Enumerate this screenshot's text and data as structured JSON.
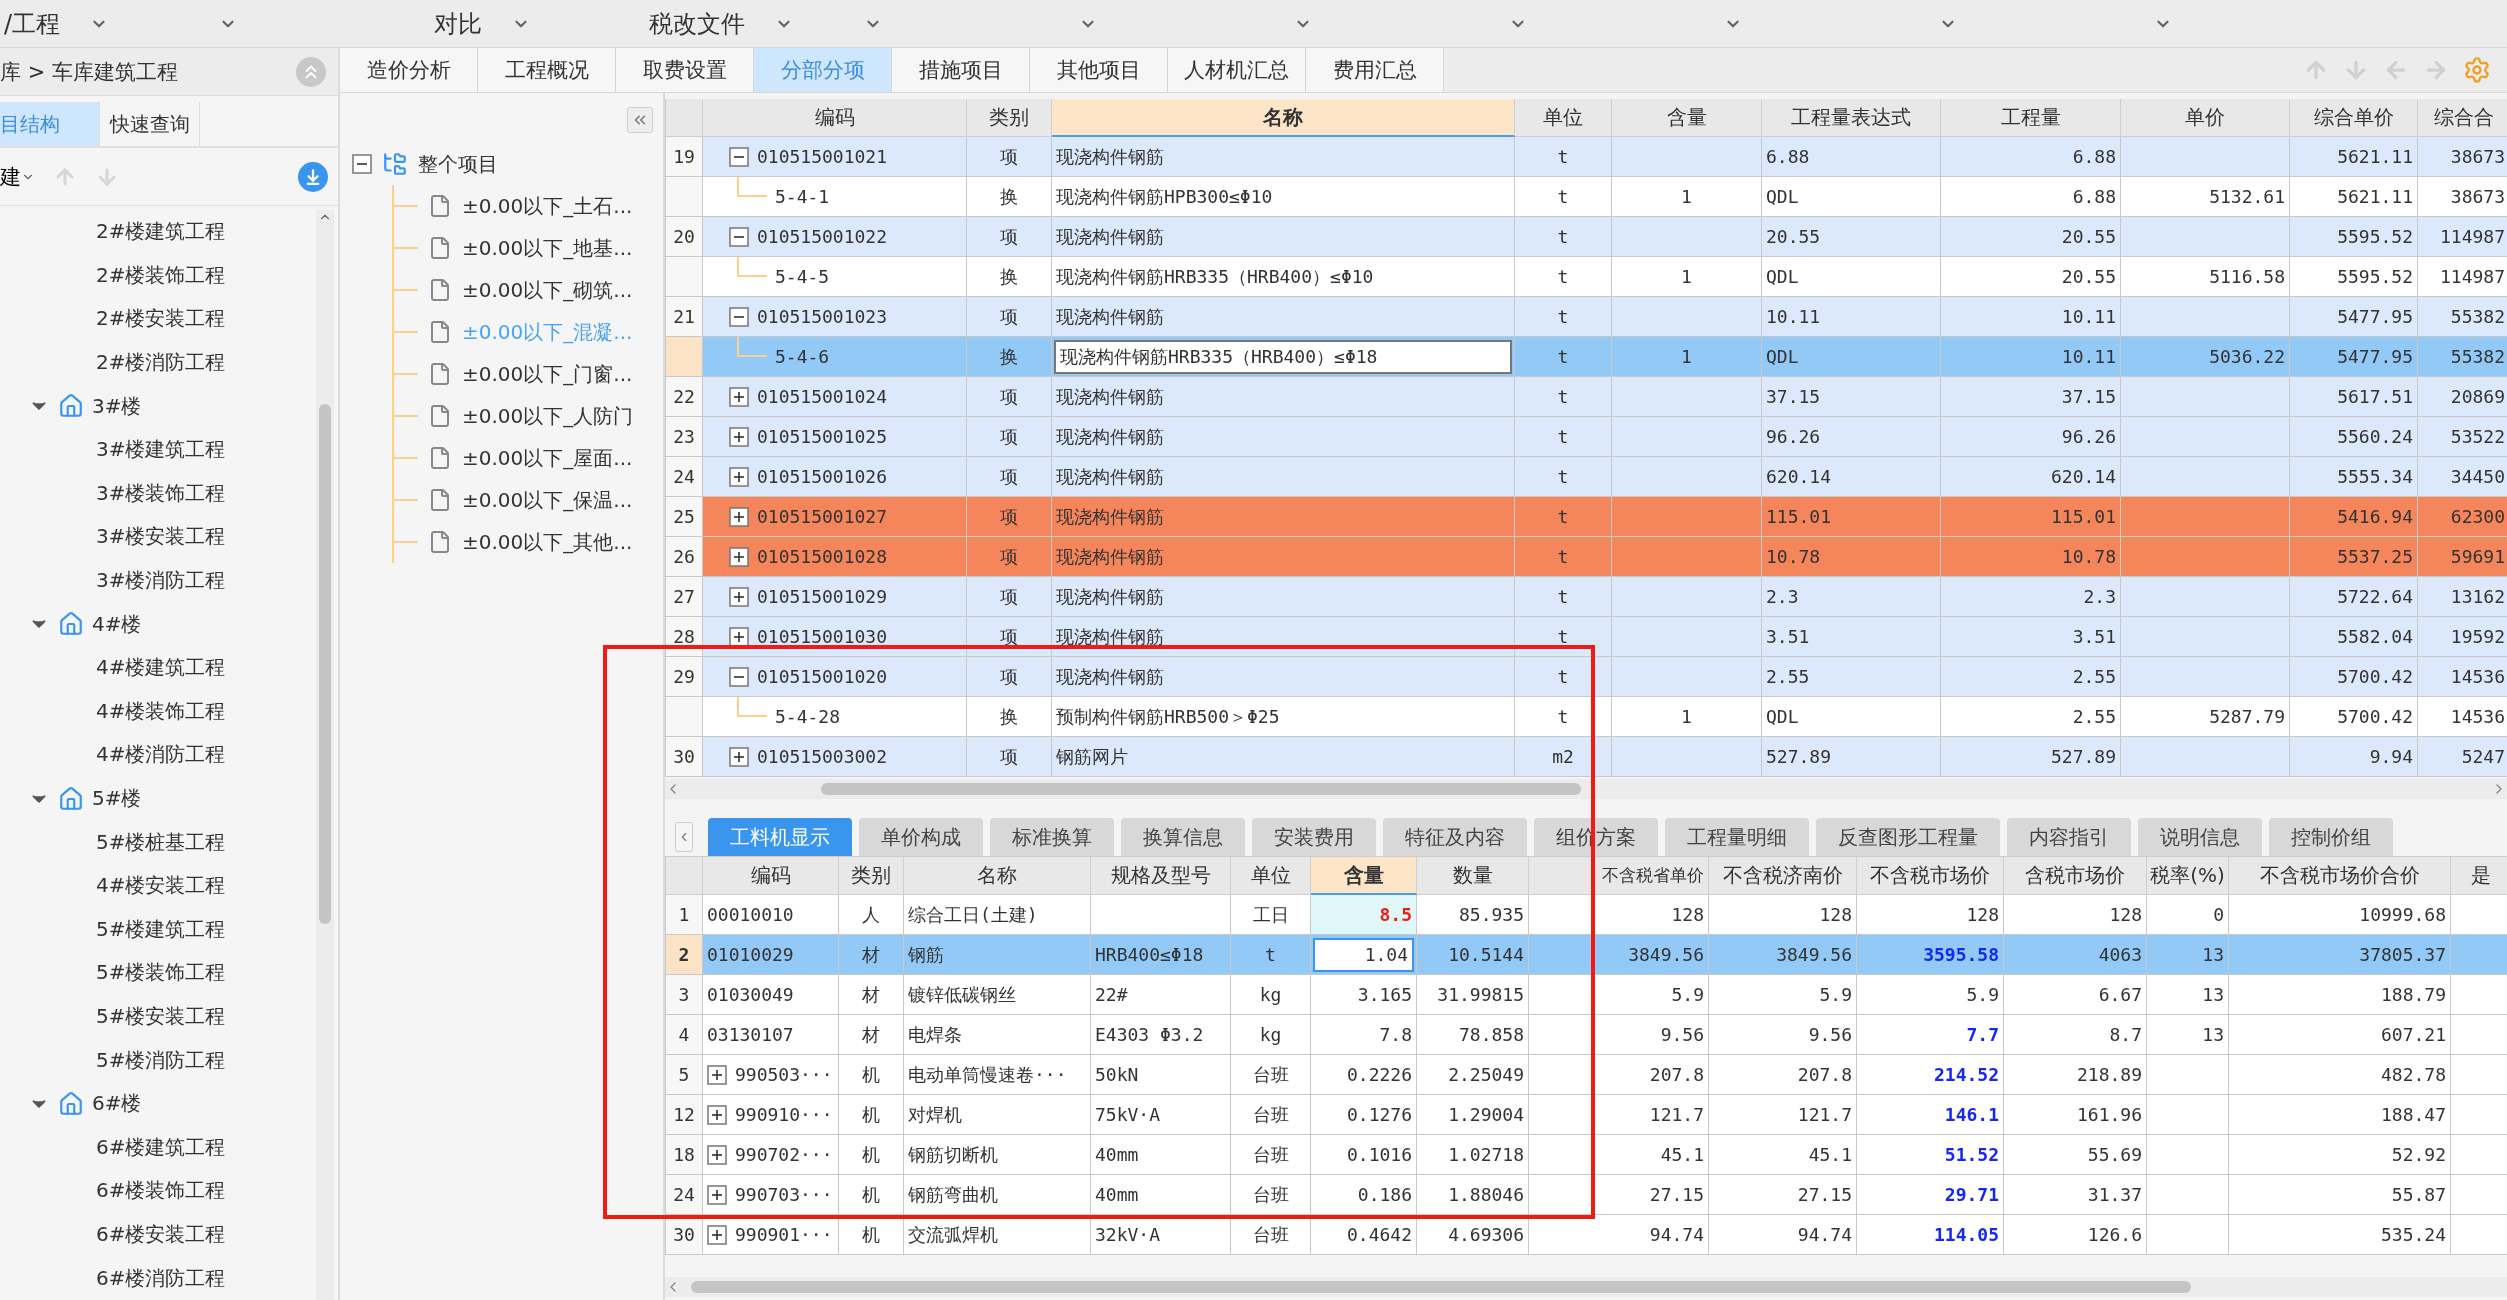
{
  "toolbar": {
    "items": [
      {
        "label": "/工程",
        "dropdown": true
      },
      {
        "dropdown": true
      },
      {
        "label": "对比",
        "dropdown": true
      },
      {
        "label": "税改文件",
        "dropdown": true
      },
      {
        "dropdown": true
      },
      {
        "dropdown": true
      },
      {
        "dropdown": true
      },
      {
        "dropdown": true
      },
      {
        "dropdown": true
      },
      {
        "dropdown": true
      },
      {
        "dropdown": true
      }
    ]
  },
  "left_panel": {
    "breadcrumb": "库 > 车库建筑工程",
    "tabs": [
      {
        "label": "目结构",
        "selected": true
      },
      {
        "label": "快速查询",
        "selected": false
      }
    ],
    "new_label": "建",
    "building_tree": [
      {
        "label": "2#楼建筑工程"
      },
      {
        "label": "2#楼装饰工程"
      },
      {
        "label": "2#楼安装工程"
      },
      {
        "label": "2#楼消防工程"
      },
      {
        "label": "3#楼",
        "expanded": true,
        "children": [
          {
            "label": "3#楼建筑工程"
          },
          {
            "label": "3#楼装饰工程"
          },
          {
            "label": "3#楼安装工程"
          },
          {
            "label": "3#楼消防工程"
          }
        ]
      },
      {
        "label": "4#楼",
        "expanded": true,
        "children": [
          {
            "label": "4#楼建筑工程"
          },
          {
            "label": "4#楼装饰工程"
          },
          {
            "label": "4#楼消防工程"
          }
        ]
      },
      {
        "label": "5#楼",
        "expanded": true,
        "children": [
          {
            "label": "5#楼桩基工程"
          },
          {
            "label": "4#楼安装工程"
          },
          {
            "label": "5#楼建筑工程"
          },
          {
            "label": "5#楼装饰工程"
          },
          {
            "label": "5#楼安装工程"
          },
          {
            "label": "5#楼消防工程"
          }
        ]
      },
      {
        "label": "6#楼",
        "expanded": true,
        "children": [
          {
            "label": "6#楼建筑工程"
          },
          {
            "label": "6#楼装饰工程"
          },
          {
            "label": "6#楼安装工程"
          },
          {
            "label": "6#楼消防工程"
          }
        ]
      }
    ]
  },
  "main_tabs": [
    {
      "label": "造价分析",
      "selected": false
    },
    {
      "label": "工程概况",
      "selected": false
    },
    {
      "label": "取费设置",
      "selected": false
    },
    {
      "label": "分部分项",
      "selected": true
    },
    {
      "label": "措施项目",
      "selected": false
    },
    {
      "label": "其他项目",
      "selected": false
    },
    {
      "label": "人材机汇总",
      "selected": false
    },
    {
      "label": "费用汇总",
      "selected": false
    }
  ],
  "project_tree": {
    "label": "整个项目",
    "expanded": true,
    "children": [
      {
        "label": "±0.00以下_土石...",
        "selected": false
      },
      {
        "label": "±0.00以下_地基...",
        "selected": false
      },
      {
        "label": "±0.00以下_砌筑...",
        "selected": false
      },
      {
        "label": "±0.00以下_混凝...",
        "selected": true
      },
      {
        "label": "±0.00以下_门窗...",
        "selected": false
      },
      {
        "label": "±0.00以下_人防门",
        "selected": false
      },
      {
        "label": "±0.00以下_屋面...",
        "selected": false
      },
      {
        "label": "±0.00以下_保温...",
        "selected": false
      },
      {
        "label": "±0.00以下_其他...",
        "selected": false
      }
    ]
  },
  "upper_table": {
    "columns": [
      {
        "label": "编码",
        "active": false
      },
      {
        "label": "类别",
        "active": false
      },
      {
        "label": "名称",
        "active": true
      },
      {
        "label": "单位",
        "active": false
      },
      {
        "label": "含量",
        "active": false
      },
      {
        "label": "工程量表达式",
        "active": false
      },
      {
        "label": "工程量",
        "active": false
      },
      {
        "label": "单价",
        "active": false
      },
      {
        "label": "综合单价",
        "active": false
      },
      {
        "label": "综合合",
        "active": false
      }
    ],
    "rows": [
      {
        "kind": "item",
        "num": "19",
        "expanded": true,
        "code": "010515001021",
        "category": "项",
        "name": "现浇构件钢筋",
        "unit": "t",
        "expr": "6.88",
        "qty": "6.88",
        "unit_total": "5621.11",
        "total": "38673",
        "selected": false,
        "flagged": false
      },
      {
        "kind": "sub",
        "code": "5-4-1",
        "category": "换",
        "name": "现浇构件钢筋HPB300≤Φ10",
        "unit": "t",
        "content": "1",
        "expr": "QDL",
        "qty": "6.88",
        "price": "5132.61",
        "unit_total": "5621.11",
        "total": "38673",
        "selected": false,
        "flagged": false
      },
      {
        "kind": "item",
        "num": "20",
        "expanded": true,
        "code": "010515001022",
        "category": "项",
        "name": "现浇构件钢筋",
        "unit": "t",
        "expr": "20.55",
        "qty": "20.55",
        "unit_total": "5595.52",
        "total": "114987",
        "selected": false,
        "flagged": false
      },
      {
        "kind": "sub",
        "code": "5-4-5",
        "category": "换",
        "name": "现浇构件钢筋HRB335（HRB400）≤Φ10",
        "unit": "t",
        "content": "1",
        "expr": "QDL",
        "qty": "20.55",
        "price": "5116.58",
        "unit_total": "5595.52",
        "total": "114987",
        "selected": false,
        "flagged": false
      },
      {
        "kind": "item",
        "num": "21",
        "expanded": true,
        "code": "010515001023",
        "category": "项",
        "name": "现浇构件钢筋",
        "unit": "t",
        "expr": "10.11",
        "qty": "10.11",
        "unit_total": "5477.95",
        "total": "55382",
        "selected": false,
        "flagged": false
      },
      {
        "kind": "sub",
        "code": "5-4-6",
        "category": "换",
        "name": "现浇构件钢筋HRB335（HRB400）≤Φ18",
        "unit": "t",
        "content": "1",
        "expr": "QDL",
        "qty": "10.11",
        "price": "5036.22",
        "unit_total": "5477.95",
        "total": "55382",
        "selected": true,
        "flagged": false
      },
      {
        "kind": "item",
        "num": "22",
        "expanded": false,
        "code": "010515001024",
        "category": "项",
        "name": "现浇构件钢筋",
        "unit": "t",
        "expr": "37.15",
        "qty": "37.15",
        "unit_total": "5617.51",
        "total": "20869",
        "selected": false,
        "flagged": false
      },
      {
        "kind": "item",
        "num": "23",
        "expanded": false,
        "code": "010515001025",
        "category": "项",
        "name": "现浇构件钢筋",
        "unit": "t",
        "expr": "96.26",
        "qty": "96.26",
        "unit_total": "5560.24",
        "total": "53522",
        "selected": false,
        "flagged": false
      },
      {
        "kind": "item",
        "num": "24",
        "expanded": false,
        "code": "010515001026",
        "category": "项",
        "name": "现浇构件钢筋",
        "unit": "t",
        "expr": "620.14",
        "qty": "620.14",
        "unit_total": "5555.34",
        "total": "34450",
        "selected": false,
        "flagged": false
      },
      {
        "kind": "item",
        "num": "25",
        "expanded": false,
        "code": "010515001027",
        "category": "项",
        "name": "现浇构件钢筋",
        "unit": "t",
        "expr": "115.01",
        "qty": "115.01",
        "unit_total": "5416.94",
        "total": "62300",
        "selected": false,
        "flagged": true
      },
      {
        "kind": "item",
        "num": "26",
        "expanded": false,
        "code": "010515001028",
        "category": "项",
        "name": "现浇构件钢筋",
        "unit": "t",
        "expr": "10.78",
        "qty": "10.78",
        "unit_total": "5537.25",
        "total": "59691",
        "selected": false,
        "flagged": true
      },
      {
        "kind": "item",
        "num": "27",
        "expanded": false,
        "code": "010515001029",
        "category": "项",
        "name": "现浇构件钢筋",
        "unit": "t",
        "expr": "2.3",
        "qty": "2.3",
        "unit_total": "5722.64",
        "total": "13162",
        "selected": false,
        "flagged": false
      },
      {
        "kind": "item",
        "num": "28",
        "expanded": false,
        "code": "010515001030",
        "category": "项",
        "name": "现浇构件钢筋",
        "unit": "t",
        "expr": "3.51",
        "qty": "3.51",
        "unit_total": "5582.04",
        "total": "19592",
        "selected": false,
        "flagged": false
      },
      {
        "kind": "item",
        "num": "29",
        "expanded": true,
        "code": "010515001020",
        "category": "项",
        "name": "现浇构件钢筋",
        "unit": "t",
        "expr": "2.55",
        "qty": "2.55",
        "unit_total": "5700.42",
        "total": "14536",
        "selected": false,
        "flagged": false
      },
      {
        "kind": "sub",
        "code": "5-4-28",
        "category": "换",
        "name": "预制构件钢筋HRB500＞Φ25",
        "unit": "t",
        "content": "1",
        "expr": "QDL",
        "qty": "2.55",
        "price": "5287.79",
        "unit_total": "5700.42",
        "total": "14536",
        "selected": false,
        "flagged": false
      },
      {
        "kind": "item",
        "num": "30",
        "expanded": false,
        "code": "010515003002",
        "category": "项",
        "name": "钢筋网片",
        "unit": "m2",
        "expr": "527.89",
        "qty": "527.89",
        "unit_total": "9.94",
        "total": "5247",
        "selected": false,
        "flagged": false
      }
    ]
  },
  "detail_tabs": [
    {
      "label": "工料机显示",
      "selected": true
    },
    {
      "label": "单价构成",
      "selected": false
    },
    {
      "label": "标准换算",
      "selected": false
    },
    {
      "label": "换算信息",
      "selected": false
    },
    {
      "label": "安装费用",
      "selected": false
    },
    {
      "label": "特征及内容",
      "selected": false
    },
    {
      "label": "组价方案",
      "selected": false
    },
    {
      "label": "工程量明细",
      "selected": false
    },
    {
      "label": "反查图形工程量",
      "selected": false
    },
    {
      "label": "内容指引",
      "selected": false
    },
    {
      "label": "说明信息",
      "selected": false
    },
    {
      "label": "控制价组",
      "selected": false
    }
  ],
  "detail_table": {
    "columns": [
      {
        "label": "编码",
        "active": false
      },
      {
        "label": "类别",
        "active": false
      },
      {
        "label": "名称",
        "active": false
      },
      {
        "label": "规格及型号",
        "active": false
      },
      {
        "label": "单位",
        "active": false
      },
      {
        "label": "含量",
        "active": true
      },
      {
        "label": "数量",
        "active": false
      },
      {
        "label": "不含税省单价",
        "active": false
      },
      {
        "label": "不含税济南价",
        "active": false
      },
      {
        "label": "不含税市场价",
        "active": false
      },
      {
        "label": "含税市场价",
        "active": false
      },
      {
        "label": "税率(%)",
        "active": false
      },
      {
        "label": "不含税市场价合价",
        "active": false
      },
      {
        "label": "是",
        "active": false
      }
    ],
    "rows": [
      {
        "num": "1",
        "code": "00010010",
        "category": "人",
        "name": "综合工日(土建)",
        "unit": "工日",
        "content": "8.5",
        "content_changed": true,
        "qty": "85.935",
        "prov_price": "128",
        "jinan_price": "128",
        "market_price": "128",
        "market_changed": false,
        "tax_market": "128",
        "tax_rate": "0",
        "total": "10999.68",
        "selected": false
      },
      {
        "num": "2",
        "code": "01010029",
        "category": "材",
        "name": "钢筋",
        "spec": "HRB400≤Φ18",
        "unit": "t",
        "content": "1.04",
        "content_changed": false,
        "qty": "10.5144",
        "prov_price": "3849.56",
        "jinan_price": "3849.56",
        "market_price": "3595.58",
        "market_changed": true,
        "tax_market": "4063",
        "tax_rate": "13",
        "total": "37805.37",
        "selected": true
      },
      {
        "num": "3",
        "code": "01030049",
        "category": "材",
        "name": "镀锌低碳钢丝",
        "spec": "22#",
        "unit": "kg",
        "content": "3.165",
        "content_changed": false,
        "qty": "31.99815",
        "prov_price": "5.9",
        "jinan_price": "5.9",
        "market_price": "5.9",
        "market_changed": false,
        "tax_market": "6.67",
        "tax_rate": "13",
        "total": "188.79",
        "selected": false
      },
      {
        "num": "4",
        "code": "03130107",
        "category": "材",
        "name": "电焊条",
        "spec": "E4303 Φ3.2",
        "unit": "kg",
        "content": "7.8",
        "content_changed": false,
        "qty": "78.858",
        "prov_price": "9.56",
        "jinan_price": "9.56",
        "market_price": "7.7",
        "market_changed": true,
        "tax_market": "8.7",
        "tax_rate": "13",
        "total": "607.21",
        "selected": false
      },
      {
        "num": "5",
        "expandable": true,
        "code": "990503···",
        "category": "机",
        "name": "电动单筒慢速卷···",
        "spec": "50kN",
        "unit": "台班",
        "content": "0.2226",
        "content_changed": false,
        "qty": "2.25049",
        "prov_price": "207.8",
        "jinan_price": "207.8",
        "market_price": "214.52",
        "market_changed": true,
        "tax_market": "218.89",
        "total": "482.78",
        "selected": false
      },
      {
        "num": "12",
        "expandable": true,
        "code": "990910···",
        "category": "机",
        "name": "对焊机",
        "spec": "75kV·A",
        "unit": "台班",
        "content": "0.1276",
        "content_changed": false,
        "qty": "1.29004",
        "prov_price": "121.7",
        "jinan_price": "121.7",
        "market_price": "146.1",
        "market_changed": true,
        "tax_market": "161.96",
        "total": "188.47",
        "selected": false
      },
      {
        "num": "18",
        "expandable": true,
        "code": "990702···",
        "category": "机",
        "name": "钢筋切断机",
        "spec": "40mm",
        "unit": "台班",
        "content": "0.1016",
        "content_changed": false,
        "qty": "1.02718",
        "prov_price": "45.1",
        "jinan_price": "45.1",
        "market_price": "51.52",
        "market_changed": true,
        "tax_market": "55.69",
        "total": "52.92",
        "selected": false
      },
      {
        "num": "24",
        "expandable": true,
        "code": "990703···",
        "category": "机",
        "name": "钢筋弯曲机",
        "spec": "40mm",
        "unit": "台班",
        "content": "0.186",
        "content_changed": false,
        "qty": "1.88046",
        "prov_price": "27.15",
        "jinan_price": "27.15",
        "market_price": "29.71",
        "market_changed": true,
        "tax_market": "31.37",
        "total": "55.87",
        "selected": false
      },
      {
        "num": "30",
        "expandable": true,
        "code": "990901···",
        "category": "机",
        "name": "交流弧焊机",
        "spec": "32kV·A",
        "unit": "台班",
        "content": "0.4642",
        "content_changed": false,
        "qty": "4.69306",
        "prov_price": "94.74",
        "jinan_price": "94.74",
        "market_price": "114.05",
        "market_changed": true,
        "tax_market": "126.6",
        "total": "535.24",
        "selected": false
      }
    ]
  }
}
